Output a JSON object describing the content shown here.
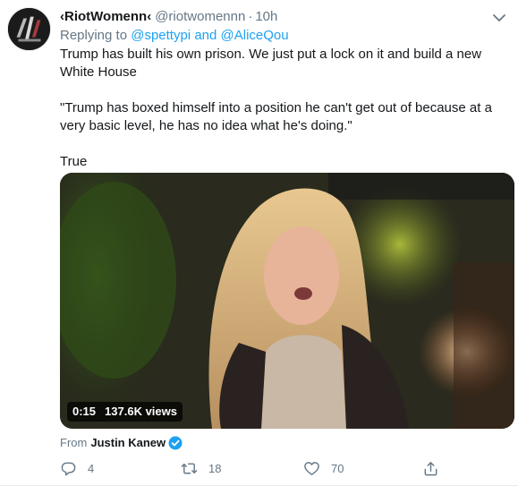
{
  "tweet": {
    "author_name": "‹RiotWomenn‹",
    "author_handle": "@riotwomennn",
    "separator": "·",
    "time": "10h",
    "replying_label": "Replying to",
    "reply_mentions": [
      "@spettypi",
      "and",
      "@AliceQou"
    ],
    "body": [
      "Trump has built his own prison.  We just put a lock on it and build a new White House",
      "\"Trump has boxed himself into a position he can't get out of because at a very basic level, he has no idea what he's doing.\"",
      "True"
    ],
    "media": {
      "duration": "0:15",
      "views": "137.6K views"
    },
    "source": {
      "from_label": "From",
      "account": "Justin Kanew"
    },
    "actions": {
      "reply_count": "4",
      "retweet_count": "18",
      "like_count": "70"
    }
  },
  "icons": {
    "menu": "chevron-down-icon",
    "verified": "verified-badge-icon",
    "reply": "reply-icon",
    "retweet": "retweet-icon",
    "like": "heart-icon",
    "share": "share-icon"
  },
  "colors": {
    "link": "#1da1f2",
    "secondary_text": "#657786",
    "primary_text": "#14171a"
  }
}
